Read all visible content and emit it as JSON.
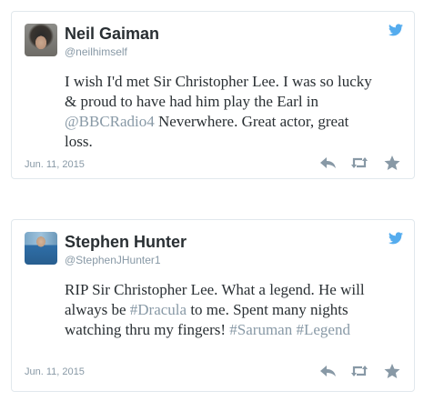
{
  "colors": {
    "name": "#292f33",
    "muted": "#8899a6",
    "bird": "#55acee",
    "icon": "#8899a6",
    "border": "#e1e8ed"
  },
  "tweets": [
    {
      "display_name": "Neil Gaiman",
      "handle": "@neilhimself",
      "text_parts": {
        "p0": "I wish I'd met Sir Christopher Lee. I was so lucky & proud to have had him play the Earl in ",
        "p1": "@BBCRadio4",
        "p2": " Neverwhere. Great actor, great loss."
      },
      "date": "Jun. 11, 2015",
      "icons": [
        "twitter-bird-icon",
        "reply-icon",
        "retweet-icon",
        "favorite-star-icon"
      ]
    },
    {
      "display_name": "Stephen Hunter",
      "handle": "@StephenJHunter1",
      "text_parts": {
        "p0": "RIP Sir Christopher Lee. What a legend. He will always be ",
        "p1": "#Dracula",
        "p2": " to me. Spent many nights watching thru my fingers! ",
        "p3": "#Saruman",
        "p4": " ",
        "p5": "#Legend"
      },
      "date": "Jun. 11, 2015",
      "icons": [
        "twitter-bird-icon",
        "reply-icon",
        "retweet-icon",
        "favorite-star-icon"
      ]
    }
  ]
}
